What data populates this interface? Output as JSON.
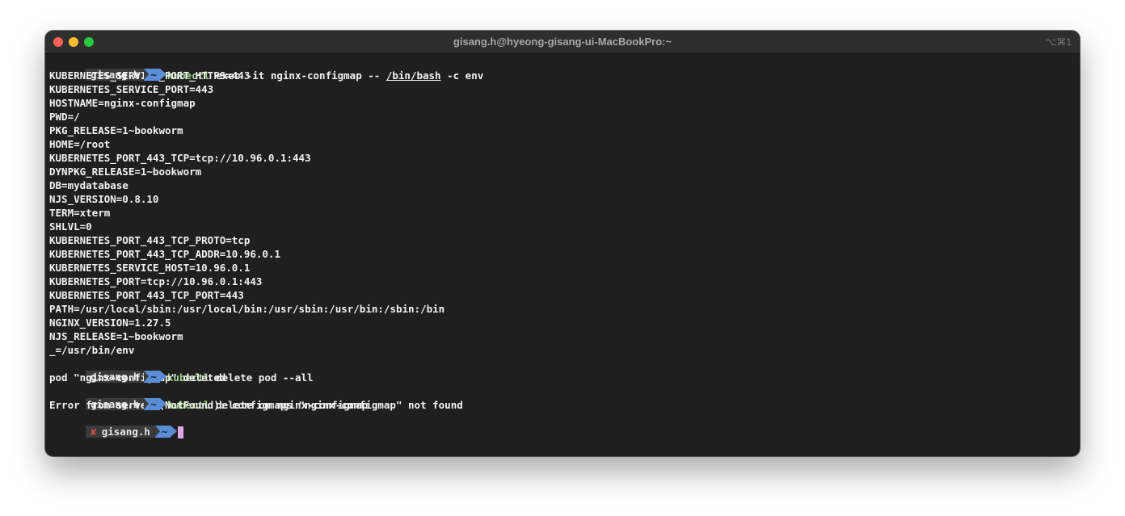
{
  "window": {
    "title": "gisang.h@hyeong-gisang-ui-MacBookPro:~",
    "shortcut": "⌥⌘1"
  },
  "prompt": {
    "user": "gisang.h",
    "cwd": "~",
    "error_mark": "✘"
  },
  "commands": {
    "c1_name": "kubectl",
    "c1_pre": " exec -it nginx-configmap -- ",
    "c1_path": "/bin/bash",
    "c1_post": " -c env",
    "c2_name": "kubectl",
    "c2_args": " delete pod --all",
    "c3_name": "kubectl",
    "c3_args": " delete cm nginx-configmap"
  },
  "env_output": [
    "KUBERNETES_SERVICE_PORT_HTTPS=443",
    "KUBERNETES_SERVICE_PORT=443",
    "HOSTNAME=nginx-configmap",
    "PWD=/",
    "PKG_RELEASE=1~bookworm",
    "HOME=/root",
    "KUBERNETES_PORT_443_TCP=tcp://10.96.0.1:443",
    "DYNPKG_RELEASE=1~bookworm",
    "DB=mydatabase",
    "NJS_VERSION=0.8.10",
    "TERM=xterm",
    "SHLVL=0",
    "KUBERNETES_PORT_443_TCP_PROTO=tcp",
    "KUBERNETES_PORT_443_TCP_ADDR=10.96.0.1",
    "KUBERNETES_SERVICE_HOST=10.96.0.1",
    "KUBERNETES_PORT=tcp://10.96.0.1:443",
    "KUBERNETES_PORT_443_TCP_PORT=443",
    "PATH=/usr/local/sbin:/usr/local/bin:/usr/sbin:/usr/bin:/sbin:/bin",
    "NGINX_VERSION=1.27.5",
    "NJS_RELEASE=1~bookworm",
    "_=/usr/bin/env"
  ],
  "outputs": {
    "delete_pod": "pod \"nginx-configmap\" deleted",
    "delete_cm_error": "Error from server (NotFound): configmaps \"nginx-configmap\" not found"
  }
}
